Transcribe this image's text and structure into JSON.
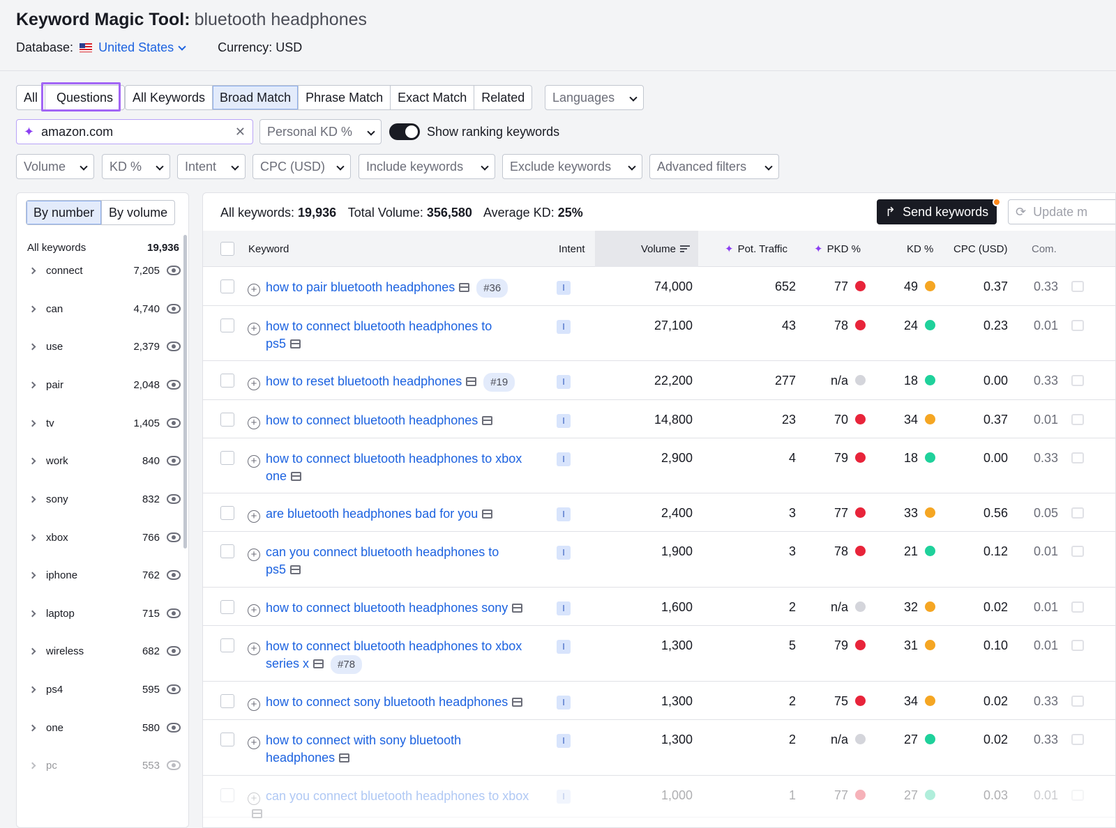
{
  "header": {
    "title": "Keyword Magic Tool:",
    "keyword": "bluetooth headphones",
    "database_label": "Database:",
    "database_value": "United States",
    "currency": "Currency: USD"
  },
  "tabs1": [
    "All",
    "Questions"
  ],
  "tabs2": [
    "All Keywords",
    "Broad Match",
    "Phrase Match",
    "Exact Match",
    "Related"
  ],
  "languages": "Languages",
  "search": {
    "value": "amazon.com"
  },
  "personal_kd": "Personal KD %",
  "show_ranking": "Show ranking keywords",
  "filters": [
    "Volume",
    "KD %",
    "Intent",
    "CPC (USD)",
    "Include keywords",
    "Exclude keywords",
    "Advanced filters"
  ],
  "sidebar": {
    "tabs": [
      "By number",
      "By volume"
    ],
    "all_label": "All keywords",
    "all_count": "19,936",
    "items": [
      {
        "label": "connect",
        "count": "7,205"
      },
      {
        "label": "can",
        "count": "4,740"
      },
      {
        "label": "use",
        "count": "2,379"
      },
      {
        "label": "pair",
        "count": "2,048"
      },
      {
        "label": "tv",
        "count": "1,405"
      },
      {
        "label": "work",
        "count": "840"
      },
      {
        "label": "sony",
        "count": "832"
      },
      {
        "label": "xbox",
        "count": "766"
      },
      {
        "label": "iphone",
        "count": "762"
      },
      {
        "label": "laptop",
        "count": "715"
      },
      {
        "label": "wireless",
        "count": "682"
      },
      {
        "label": "ps4",
        "count": "595"
      },
      {
        "label": "one",
        "count": "580"
      },
      {
        "label": "pc",
        "count": "553"
      }
    ]
  },
  "summary": {
    "all_label": "All keywords:",
    "all_value": "19,936",
    "vol_label": "Total Volume:",
    "vol_value": "356,580",
    "kd_label": "Average KD:",
    "kd_value": "25%"
  },
  "send_keywords": "Send keywords",
  "update": "Update m",
  "columns": {
    "keyword": "Keyword",
    "intent": "Intent",
    "volume": "Volume",
    "pot_traffic": "Pot. Traffic",
    "pkd": "PKD %",
    "kd": "KD %",
    "cpc": "CPC (USD)",
    "com": "Com."
  },
  "colors": {
    "red": "#e8243a",
    "orange": "#f5a623",
    "green": "#1fd19b",
    "gray": "#d4d5db",
    "link": "#1d63e0"
  },
  "rows": [
    {
      "l1": "how to pair bluetooth headphones",
      "l2": "",
      "rank": "#36",
      "intent": "I",
      "volume": "74,000",
      "traffic": "652",
      "pkd": "77",
      "pkd_c": "red",
      "kd": "49",
      "kd_c": "orange",
      "cpc": "0.37",
      "com": "0.33"
    },
    {
      "l1": "how to connect bluetooth headphones to",
      "l2": "ps5",
      "rank": "",
      "intent": "I",
      "volume": "27,100",
      "traffic": "43",
      "pkd": "78",
      "pkd_c": "red",
      "kd": "24",
      "kd_c": "green",
      "cpc": "0.23",
      "com": "0.01"
    },
    {
      "l1": "how to reset bluetooth headphones",
      "l2": "",
      "rank": "#19",
      "intent": "I",
      "volume": "22,200",
      "traffic": "277",
      "pkd": "n/a",
      "pkd_c": "gray",
      "kd": "18",
      "kd_c": "green",
      "cpc": "0.00",
      "com": "0.33"
    },
    {
      "l1": "how to connect bluetooth headphones",
      "l2": "",
      "rank": "",
      "intent": "I",
      "volume": "14,800",
      "traffic": "23",
      "pkd": "70",
      "pkd_c": "red",
      "kd": "34",
      "kd_c": "orange",
      "cpc": "0.37",
      "com": "0.01"
    },
    {
      "l1": "how to connect bluetooth headphones to xbox",
      "l2": "one",
      "rank": "",
      "intent": "I",
      "volume": "2,900",
      "traffic": "4",
      "pkd": "79",
      "pkd_c": "red",
      "kd": "18",
      "kd_c": "green",
      "cpc": "0.00",
      "com": "0.33"
    },
    {
      "l1": "are bluetooth headphones bad for you",
      "l2": "",
      "rank": "",
      "intent": "I",
      "volume": "2,400",
      "traffic": "3",
      "pkd": "77",
      "pkd_c": "red",
      "kd": "33",
      "kd_c": "orange",
      "cpc": "0.56",
      "com": "0.05"
    },
    {
      "l1": "can you connect bluetooth headphones to",
      "l2": "ps5",
      "rank": "",
      "intent": "I",
      "volume": "1,900",
      "traffic": "3",
      "pkd": "78",
      "pkd_c": "red",
      "kd": "21",
      "kd_c": "green",
      "cpc": "0.12",
      "com": "0.01"
    },
    {
      "l1": "how to connect bluetooth headphones sony",
      "l2": "",
      "rank": "",
      "intent": "I",
      "volume": "1,600",
      "traffic": "2",
      "pkd": "n/a",
      "pkd_c": "gray",
      "kd": "32",
      "kd_c": "orange",
      "cpc": "0.02",
      "com": "0.01"
    },
    {
      "l1": "how to connect bluetooth headphones to xbox",
      "l2": "series x",
      "rank": "#78",
      "intent": "I",
      "volume": "1,300",
      "traffic": "5",
      "pkd": "79",
      "pkd_c": "red",
      "kd": "31",
      "kd_c": "orange",
      "cpc": "0.10",
      "com": "0.01"
    },
    {
      "l1": "how to connect sony bluetooth headphones",
      "l2": "",
      "rank": "",
      "intent": "I",
      "volume": "1,300",
      "traffic": "2",
      "pkd": "75",
      "pkd_c": "red",
      "kd": "34",
      "kd_c": "orange",
      "cpc": "0.02",
      "com": "0.33"
    },
    {
      "l1": "how to connect with sony bluetooth",
      "l2": "headphones",
      "rank": "",
      "intent": "I",
      "volume": "1,300",
      "traffic": "2",
      "pkd": "n/a",
      "pkd_c": "gray",
      "kd": "27",
      "kd_c": "green",
      "cpc": "0.02",
      "com": "0.33"
    },
    {
      "l1": "can you connect bluetooth headphones to xbox",
      "l2": "",
      "rank": "",
      "intent": "I",
      "volume": "1,000",
      "traffic": "1",
      "pkd": "77",
      "pkd_c": "red",
      "kd": "27",
      "kd_c": "green",
      "cpc": "0.03",
      "com": "0.01"
    }
  ]
}
